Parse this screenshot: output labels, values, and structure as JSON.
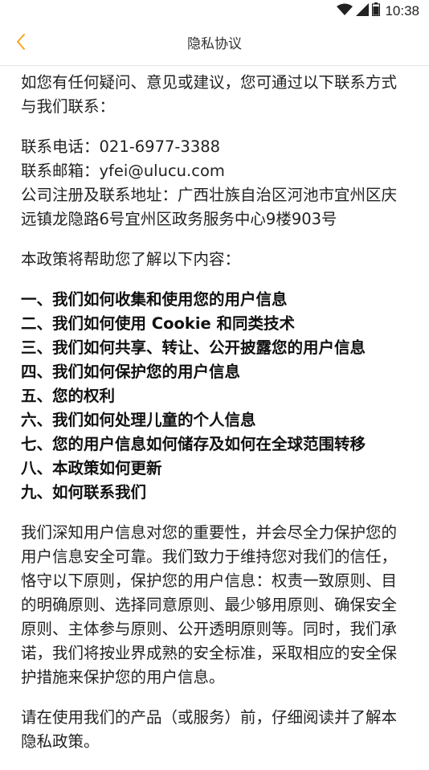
{
  "status_bar": {
    "time": "10:38",
    "icons": [
      "wifi-icon",
      "signal-icon",
      "battery-icon"
    ]
  },
  "nav": {
    "back_icon": "chevron-left-icon",
    "title": "隐私协议",
    "accent_color": "#f5a623"
  },
  "content": {
    "intro": "如您有任何疑问、意见或建议，您可通过以下联系方式与我们联系：",
    "phone": "联系电话：021-6977-3388",
    "email": "联系邮箱：yfei@ulucu.com",
    "address": "公司注册及联系地址：广西壮族自治区河池市宜州区庆远镇龙隐路6号宜州区政务服务中心9楼903号",
    "help_intro": "本政策将帮助您了解以下内容：",
    "toc": [
      "一、我们如何收集和使用您的用户信息",
      "二、我们如何使用 Cookie 和同类技术",
      "三、我们如何共享、转让、公开披露您的用户信息",
      "四、我们如何保护您的用户信息",
      "五、您的权利",
      "六、我们如何处理儿童的个人信息",
      "七、您的用户信息如何储存及如何在全球范围转移",
      "八、本政策如何更新",
      "九、如何联系我们"
    ],
    "principles": "我们深知用户信息对您的重要性，并会尽全力保护您的用户信息安全可靠。我们致力于维持您对我们的信任，恪守以下原则，保护您的用户信息：权责一致原则、目的明确原则、选择同意原则、最少够用原则、确保安全原则、主体参与原则、公开透明原则等。同时，我们承诺，我们将按业界成熟的安全标准，采取相应的安全保护措施来保护您的用户信息。",
    "read_notice": "请在使用我们的产品（或服务）前，仔细阅读并了解本隐私政策。"
  }
}
